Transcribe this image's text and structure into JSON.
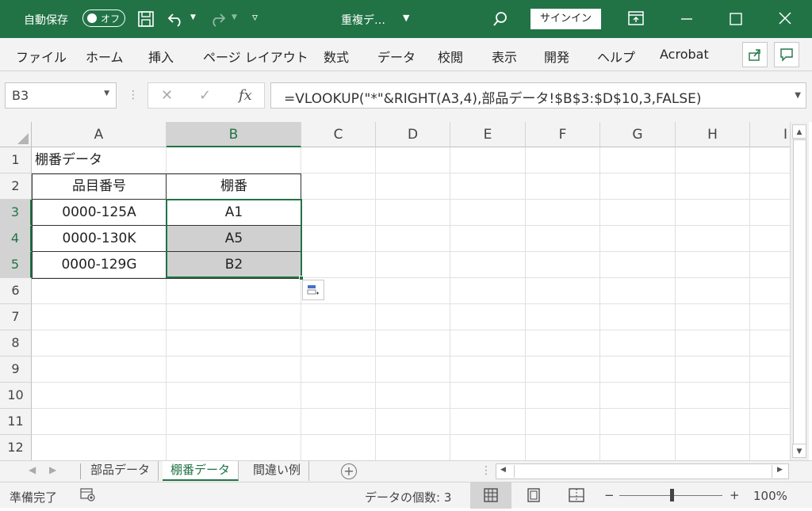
{
  "titlebar": {
    "autosave_label": "自動保存",
    "autosave_state": "オフ",
    "document_title": "重複デ…",
    "signin_label": "サインイン"
  },
  "ribbon": {
    "tabs": [
      "ファイル",
      "ホーム",
      "挿入",
      "ページ レイアウト",
      "数式",
      "データ",
      "校閲",
      "表示",
      "開発",
      "ヘルプ",
      "Acrobat"
    ]
  },
  "formula_bar": {
    "name_box": "B3",
    "formula": "=VLOOKUP(\"*\"&RIGHT(A3,4),部品データ!$B$3:$D$10,3,FALSE)"
  },
  "grid": {
    "columns": [
      "A",
      "B",
      "C",
      "D",
      "E",
      "F",
      "G",
      "H",
      "I"
    ],
    "rows": [
      "1",
      "2",
      "3",
      "4",
      "5",
      "6",
      "7",
      "8",
      "9",
      "10",
      "11",
      "12"
    ],
    "cells": {
      "A1": "棚番データ",
      "A2": "品目番号",
      "B2": "棚番",
      "A3": "0000-125A",
      "B3": "A1",
      "A4": "0000-130K",
      "B4": "A5",
      "A5": "0000-129G",
      "B5": "B2"
    }
  },
  "sheet_tabs": [
    "部品データ",
    "棚番データ",
    "間違い例"
  ],
  "active_sheet": "棚番データ",
  "statusbar": {
    "ready": "準備完了",
    "count": "データの個数: 3",
    "zoom": "100%",
    "zoom_minus": "−",
    "zoom_plus": "+"
  },
  "colors": {
    "accent": "#217346",
    "selection_fill": "#d0d0d0"
  }
}
